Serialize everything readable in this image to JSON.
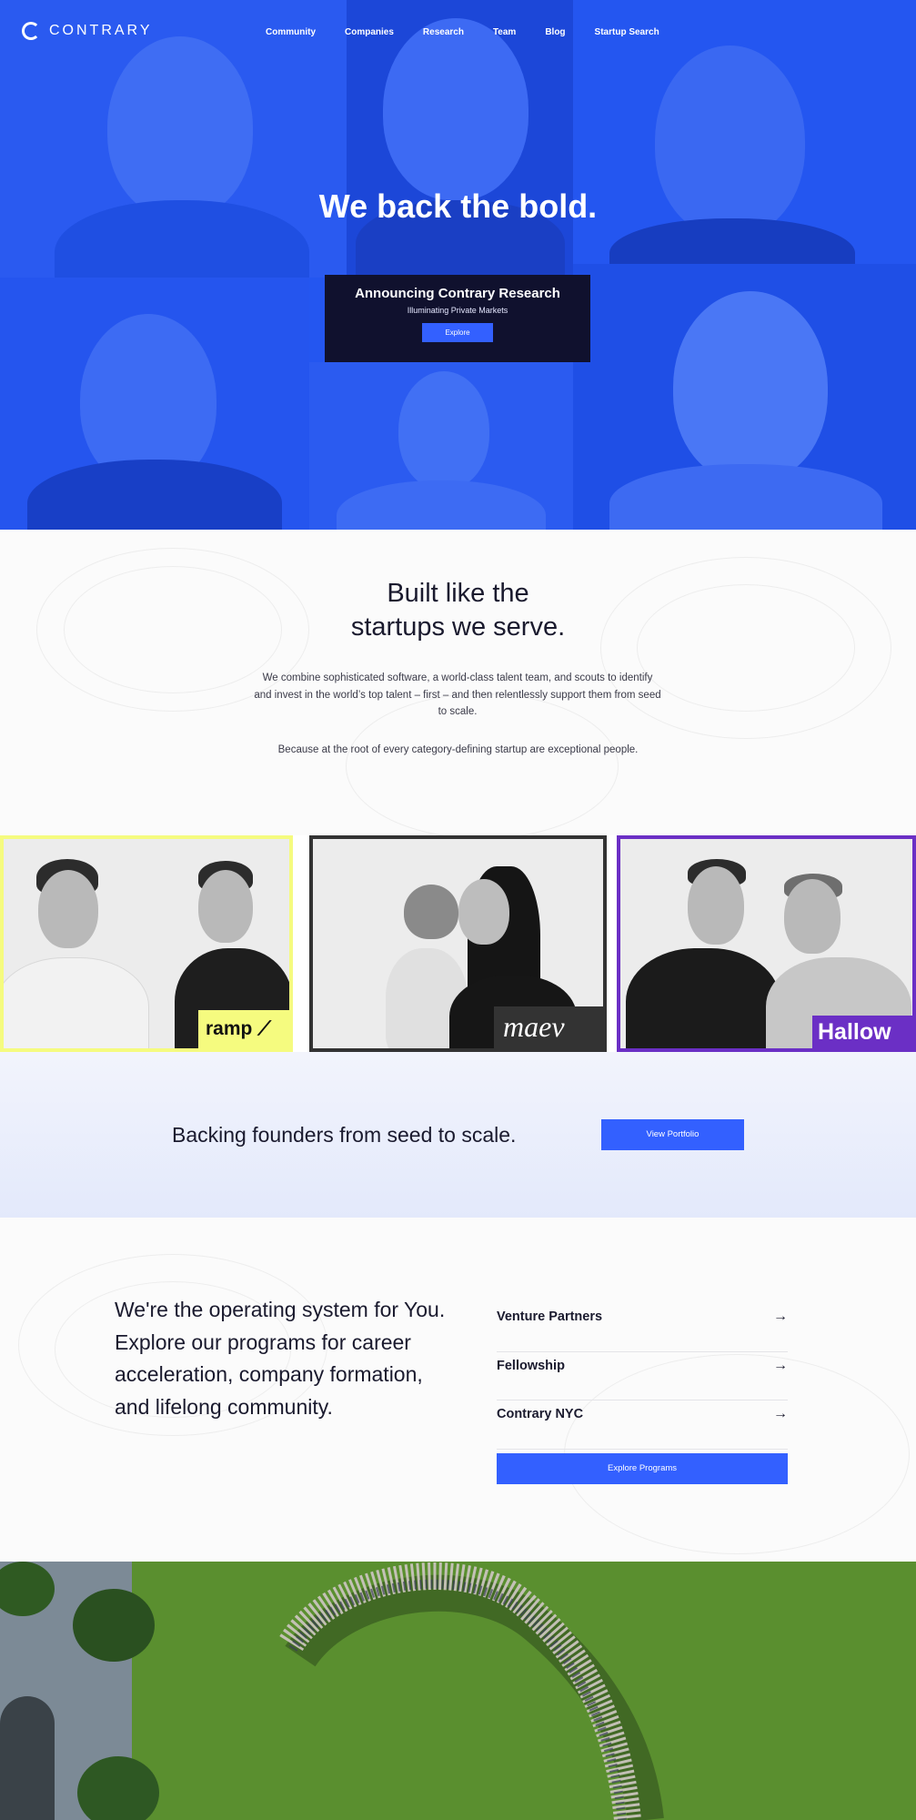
{
  "brand": {
    "logo_text": "CONTRARY",
    "logo_icon": "contrary-logo-icon"
  },
  "nav": {
    "items": [
      "Community",
      "Companies",
      "Research",
      "Team",
      "Blog",
      "Startup Search"
    ]
  },
  "hero": {
    "title": "We back the bold.",
    "announcement": {
      "title": "Announcing Contrary Research",
      "subtitle": "Illuminating Private Markets",
      "button": "Explore"
    },
    "accent": "#2456f0"
  },
  "built": {
    "heading_line1": "Built like the",
    "heading_line2": "startups we serve.",
    "paragraph": "We combine sophisticated software, a world-class talent team, and scouts to identify and invest in the world’s top talent – first – and then relentlessly support them from seed to scale.",
    "paragraph2": "Because at the root of every category-defining startup are exceptional people."
  },
  "portfolio_cards": [
    {
      "brand": "ramp",
      "border_color": "#f5fb7f"
    },
    {
      "brand": "maev",
      "border_color": "#333333"
    },
    {
      "brand": "Hallow",
      "border_color": "#6b2fc5"
    }
  ],
  "backing": {
    "text": "Backing founders from seed to scale.",
    "button": "View Portfolio"
  },
  "programs": {
    "lead": "We're the operating system for You. Explore our programs for career acceleration, company formation, and lifelong community.",
    "items": [
      "Venture Partners",
      "Fellowship",
      "Contrary NYC"
    ],
    "arrow_icon": "arrow-right-icon",
    "button": "Explore Programs"
  },
  "colors": {
    "primary_button": "#3360ff",
    "dark_box": "#10112e"
  }
}
